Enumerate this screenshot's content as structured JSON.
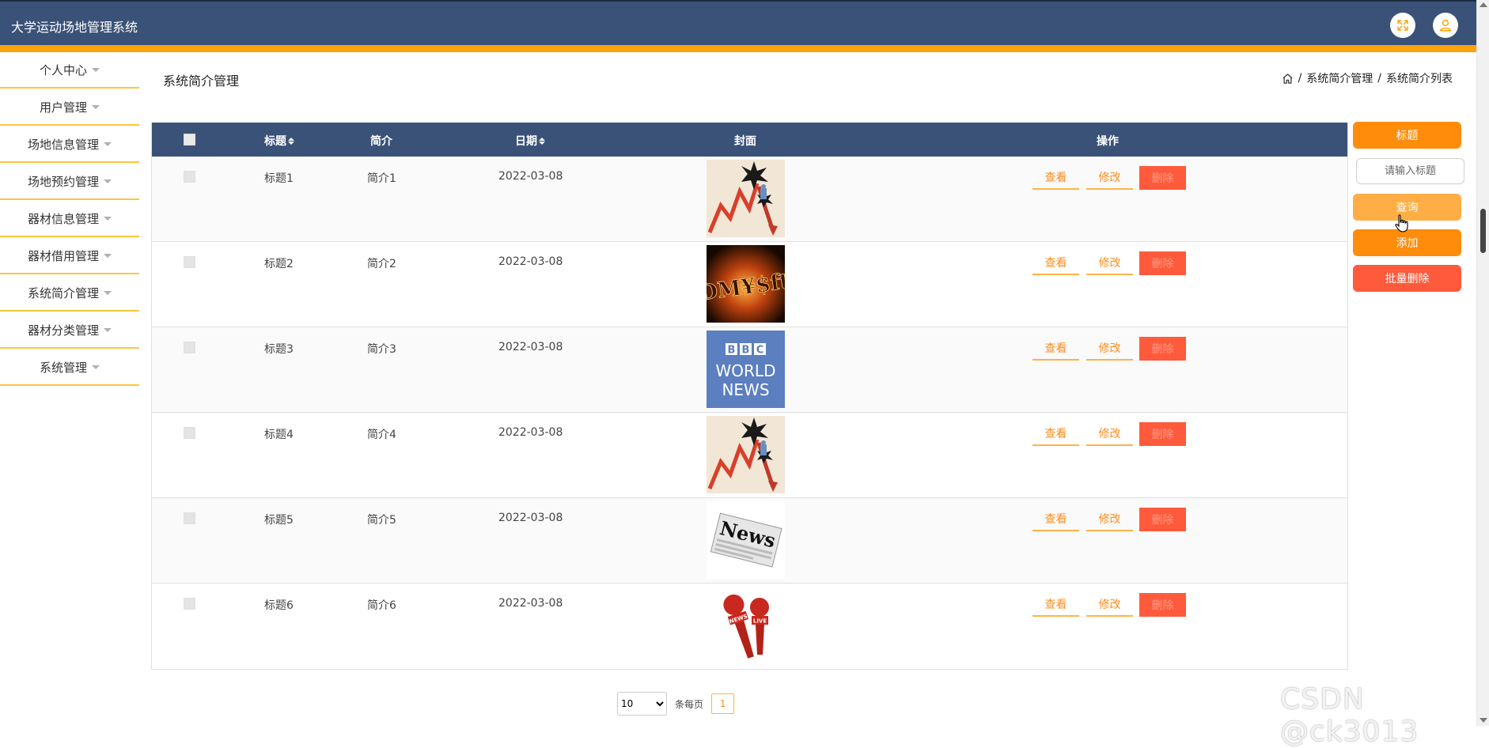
{
  "app": {
    "title": "大学运动场地管理系统"
  },
  "header": {
    "fullscreen_icon": "fullscreen-icon",
    "user_icon": "user-icon"
  },
  "sidebar": {
    "items": [
      {
        "label": "个人中心"
      },
      {
        "label": "用户管理"
      },
      {
        "label": "场地信息管理"
      },
      {
        "label": "场地预约管理"
      },
      {
        "label": "器材信息管理"
      },
      {
        "label": "器材借用管理"
      },
      {
        "label": "系统简介管理"
      },
      {
        "label": "器材分类管理"
      },
      {
        "label": "系统管理"
      }
    ]
  },
  "page": {
    "title": "系统简介管理"
  },
  "breadcrumb": {
    "items": [
      "系统简介管理",
      "系统简介列表"
    ],
    "separator": "/"
  },
  "table": {
    "headers": {
      "title": "标题",
      "intro": "简介",
      "date": "日期",
      "cover": "封面",
      "ops": "操作"
    },
    "rows": [
      {
        "title": "标题1",
        "intro": "简介1",
        "date": "2022-03-08",
        "cover": "stock-crash"
      },
      {
        "title": "标题2",
        "intro": "简介2",
        "date": "2022-03-08",
        "cover": "currency-fire"
      },
      {
        "title": "标题3",
        "intro": "简介3",
        "date": "2022-03-08",
        "cover": "bbc-world-news"
      },
      {
        "title": "标题4",
        "intro": "简介4",
        "date": "2022-03-08",
        "cover": "stock-crash"
      },
      {
        "title": "标题5",
        "intro": "简介5",
        "date": "2022-03-08",
        "cover": "news-paper"
      },
      {
        "title": "标题6",
        "intro": "简介6",
        "date": "2022-03-08",
        "cover": "news-microphones"
      }
    ],
    "actions": {
      "view": "查看",
      "edit": "修改",
      "delete": "删除"
    }
  },
  "cover_text": {
    "bbc": [
      "B",
      "B",
      "C"
    ],
    "world": "WORLD",
    "news": "NEWS",
    "paper": "News",
    "mic_live": "LIVE",
    "mic_news": "NEWS",
    "currency": "DM¥$ft"
  },
  "search_panel": {
    "label": "标题",
    "input_placeholder": "请输入标题",
    "query_button": "查询",
    "add_button": "添加",
    "bulk_delete_button": "批量删除"
  },
  "pagination": {
    "page_size": "10",
    "page_size_options": [
      "10"
    ],
    "per_page_label": "条每页",
    "current_page": "1"
  },
  "watermark": "CSDN @ck3013",
  "colors": {
    "header": "#3a5278",
    "accent": "#ffa30a",
    "primary": "#ff8c0a",
    "danger": "#ff5a3c"
  }
}
